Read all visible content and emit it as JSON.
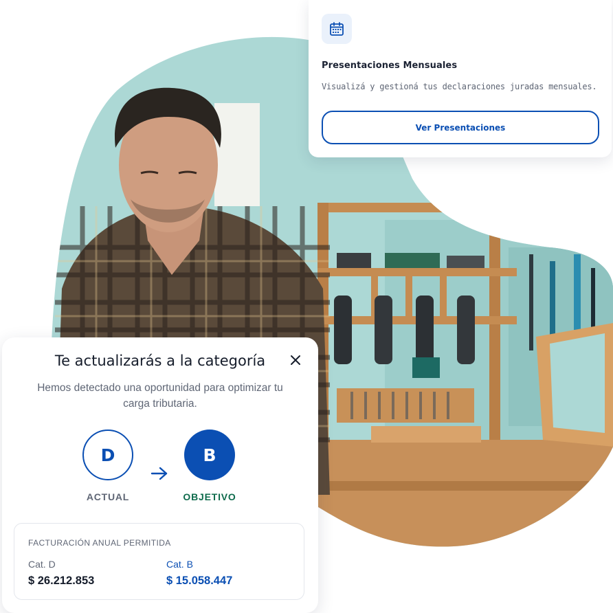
{
  "presentaciones_card": {
    "icon": "calendar-icon",
    "title": "Presentaciones Mensuales",
    "description": "Visualizá y gestioná tus declaraciones juradas mensuales.",
    "button_label": "Ver Presentaciones"
  },
  "photo": {
    "subject": "man-in-plaid-shirt-workshop-photo"
  },
  "categoria_modal": {
    "title": "Te actualizarás a la categoría",
    "subtitle": "Hemos detectado una oportunidad para optimizar tu carga tributaria.",
    "close_icon": "close-icon",
    "current": {
      "letter": "D",
      "label": "ACTUAL"
    },
    "target": {
      "letter": "B",
      "label": "OBJETIVO"
    },
    "arrow_icon": "arrow-right-icon",
    "facturacion": {
      "heading": "FACTURACIÓN ANUAL PERMITIDA",
      "current_cat": "Cat. D",
      "current_amount": "$ 26.212.853",
      "target_cat": "Cat. B",
      "target_amount": "$ 15.058.447"
    }
  },
  "colors": {
    "primary_blue": "#0b4fb3",
    "target_green": "#0e6b4c",
    "icon_bg": "#eaf1fb",
    "wall_teal": "#a9d6d3",
    "wood": "#c9925a"
  }
}
